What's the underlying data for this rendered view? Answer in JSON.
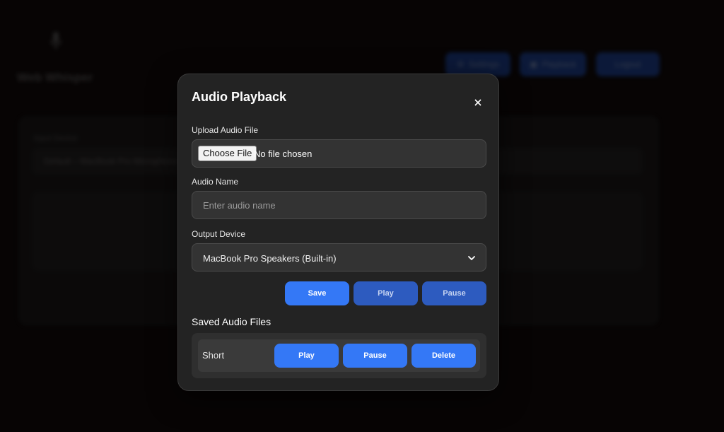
{
  "background": {
    "app_title": "Web Whisper",
    "nav": [
      "Settings",
      "Playback",
      "Logout"
    ],
    "input_device_label": "Input Device",
    "input_device_value": "Default – MacBook Pro Microphone (Built-in)"
  },
  "modal": {
    "title": "Audio Playback",
    "close_icon": "close-icon",
    "upload": {
      "label": "Upload Audio File",
      "button": "Choose File",
      "status": "No file chosen"
    },
    "audio_name": {
      "label": "Audio Name",
      "placeholder": "Enter audio name",
      "value": ""
    },
    "output_device": {
      "label": "Output Device",
      "selected": "MacBook Pro Speakers (Built-in)"
    },
    "actions": {
      "save": "Save",
      "play": "Play",
      "pause": "Pause"
    },
    "saved": {
      "title": "Saved Audio Files",
      "items": [
        {
          "name": "Short",
          "play": "Play",
          "pause": "Pause",
          "delete": "Delete"
        }
      ]
    }
  },
  "colors": {
    "accent": "#3478f6",
    "accent_muted": "#2d5bbf",
    "modal_bg": "#232323",
    "page_bg": "#0d0808"
  }
}
